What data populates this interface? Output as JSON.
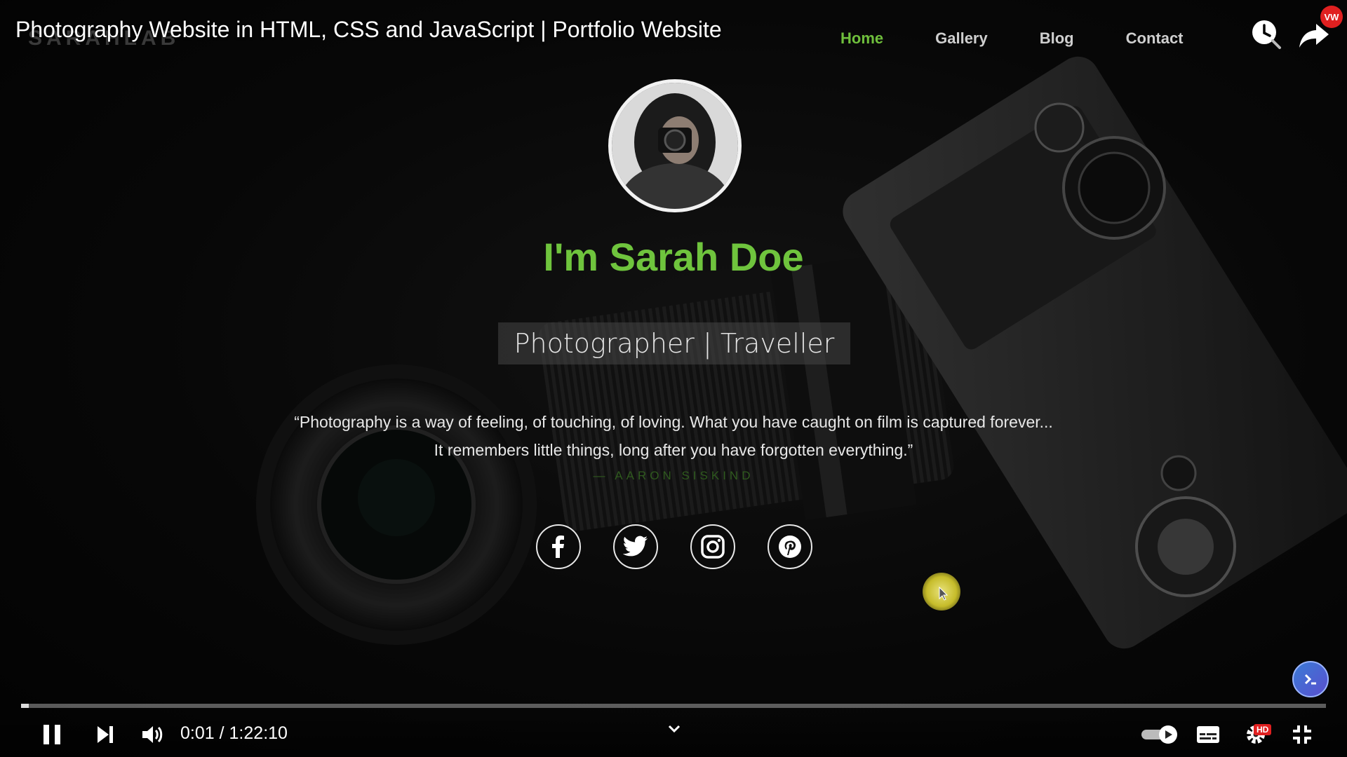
{
  "video": {
    "title": "Photography Website in HTML, CSS and JavaScript | Portfolio Website",
    "time_current": "0:01",
    "time_total": "1:22:10",
    "time_separator": "/",
    "progress": 0.006,
    "badges": {
      "channel": "VW",
      "quality": "HD"
    }
  },
  "site": {
    "logo": "SARAHLAB",
    "nav": [
      {
        "label": "Home",
        "active": true
      },
      {
        "label": "Gallery",
        "active": false
      },
      {
        "label": "Blog",
        "active": false
      },
      {
        "label": "Contact",
        "active": false
      }
    ],
    "hero": {
      "name": "I'm Sarah Doe",
      "role": "Photographer | Traveller",
      "quote_line1": "“Photography is a way of feeling, of touching, of loving. What you have caught on film is captured forever...",
      "quote_line2": "It remembers little things, long after you have forgotten everything.”",
      "quote_author": "— AARON SISKIND"
    },
    "socials": [
      "facebook-icon",
      "twitter-icon",
      "instagram-icon",
      "pinterest-icon"
    ]
  },
  "colors": {
    "accent": "#6fc43d",
    "badge_red": "#e02020"
  },
  "icons": [
    "watch-later-icon",
    "share-icon",
    "pause-icon",
    "next-icon",
    "volume-icon",
    "chevron-down-icon",
    "autoplay-toggle-icon",
    "subtitles-icon",
    "settings-icon",
    "exit-fullscreen-icon",
    "assistant-icon"
  ]
}
